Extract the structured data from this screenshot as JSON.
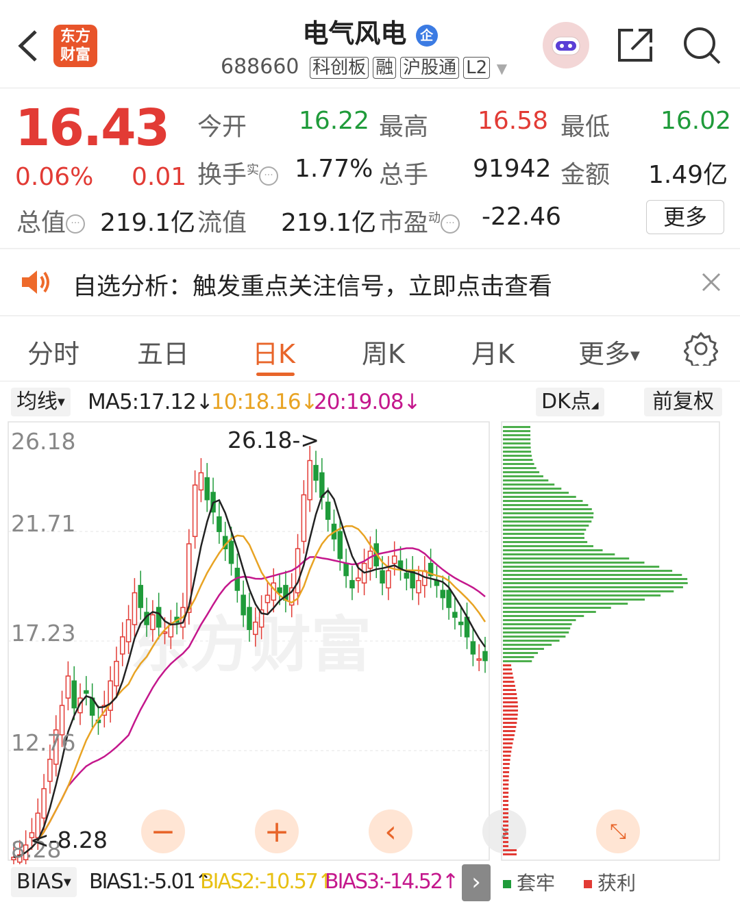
{
  "header": {
    "logo_text": "东方财富",
    "title": "电气风电",
    "title_badge": "企",
    "code": "688660",
    "tags": [
      "科创板",
      "融",
      "沪股通",
      "L2"
    ]
  },
  "quote": {
    "price": "16.43",
    "change_pct": "0.06%",
    "change": "0.01",
    "fields": {
      "open_label": "今开",
      "open": "16.22",
      "high_label": "最高",
      "high": "16.58",
      "low_label": "最低",
      "low": "16.02",
      "turnover_label": "换手",
      "turnover_sup": "实",
      "turnover": "1.77%",
      "volume_label": "总手",
      "volume": "91942",
      "amount_label": "金额",
      "amount": "1.49亿",
      "mcap_label": "总值",
      "mcap": "219.1亿",
      "float_label": "流值",
      "float": "219.1亿",
      "pe_label": "市盈",
      "pe_sup": "动",
      "pe": "-22.46"
    },
    "more_label": "更多"
  },
  "notice": {
    "text": "自选分析：触发重点关注信号，立即点击查看"
  },
  "tabs": [
    {
      "label": "分时"
    },
    {
      "label": "五日"
    },
    {
      "label": "日K"
    },
    {
      "label": "周K"
    },
    {
      "label": "月K"
    },
    {
      "label": "更多"
    }
  ],
  "active_tab": "日K",
  "ma_bar": {
    "selector": "均线",
    "ma5": "MA5:17.12",
    "ma10": "10:18.16",
    "ma20": "20:19.08",
    "dk_label": "DK点",
    "adjust_label": "前复权",
    "colors": {
      "ma5": "#222222",
      "ma10": "#e8a323",
      "ma20": "#c4178c"
    }
  },
  "chart": {
    "y_labels": [
      "26.18",
      "21.71",
      "17.23",
      "12.76",
      "8.28"
    ],
    "max_marker": "26.18->",
    "min_marker": "<-8.28",
    "watermark": "东方财富"
  },
  "chart_data": {
    "type": "candlestick",
    "ylim": [
      8.28,
      26.18
    ],
    "y_ticks": [
      26.18,
      21.71,
      17.23,
      12.76,
      8.28
    ],
    "max_price": 26.18,
    "min_price": 8.28,
    "series": [
      {
        "name": "MA5",
        "value": 17.12
      },
      {
        "name": "MA10",
        "value": 18.16
      },
      {
        "name": "MA20",
        "value": 19.08
      }
    ]
  },
  "bias_bar": {
    "selector": "BIAS",
    "bias1": "BIAS1:-5.01",
    "bias2": "BIAS2:-10.57",
    "bias3": "BIAS3:-14.52"
  },
  "legend": {
    "trap": "套牢",
    "profit": "获利"
  },
  "colors": {
    "up": "#e23b35",
    "down": "#1f9b3a",
    "accent": "#e8652a"
  }
}
